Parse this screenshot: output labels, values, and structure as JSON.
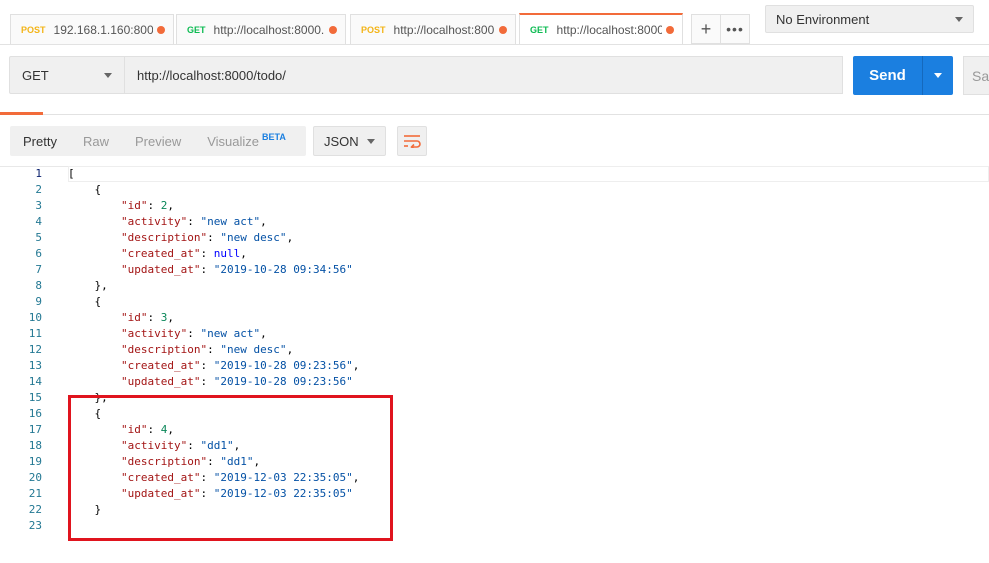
{
  "tabs": [
    {
      "method": "POST",
      "url": "192.168.1.160:8000...",
      "kind": "post",
      "active": false
    },
    {
      "method": "GET",
      "url": "http://localhost:8000...",
      "kind": "get",
      "active": false
    },
    {
      "method": "POST",
      "url": "http://localhost:800...",
      "kind": "post",
      "active": false
    },
    {
      "method": "GET",
      "url": "http://localhost:8000...",
      "kind": "get",
      "active": true
    }
  ],
  "tab_actions": {
    "add_icon": "plus-icon",
    "more_icon": "more-icon"
  },
  "environment": {
    "selected": "No Environment"
  },
  "request": {
    "method": "GET",
    "url": "http://localhost:8000/todo/",
    "send_label": "Send",
    "save_label": "Sav"
  },
  "response_view": {
    "tabs": [
      "Pretty",
      "Raw",
      "Preview",
      "Visualize"
    ],
    "active_tab": "Pretty",
    "beta_badge": "BETA",
    "format": "JSON",
    "wrap_icon": "wrap-lines-icon"
  },
  "code_lines": [
    "[",
    "    {",
    "        \"id\": 2,",
    "        \"activity\": \"new act\",",
    "        \"description\": \"new desc\",",
    "        \"created_at\": null,",
    "        \"updated_at\": \"2019-10-28 09:34:56\"",
    "    },",
    "    {",
    "        \"id\": 3,",
    "        \"activity\": \"new act\",",
    "        \"description\": \"new desc\",",
    "        \"created_at\": \"2019-10-28 09:23:56\",",
    "        \"updated_at\": \"2019-10-28 09:23:56\"",
    "    },",
    "    {",
    "        \"id\": 4,",
    "        \"activity\": \"dd1\",",
    "        \"description\": \"dd1\",",
    "        \"created_at\": \"2019-12-03 22:35:05\",",
    "        \"updated_at\": \"2019-12-03 22:35:05\"",
    "    }",
    ""
  ],
  "colors": {
    "accent": "#f26b3a",
    "send": "#1b7fe0",
    "highlight_box": "#e0141e"
  }
}
